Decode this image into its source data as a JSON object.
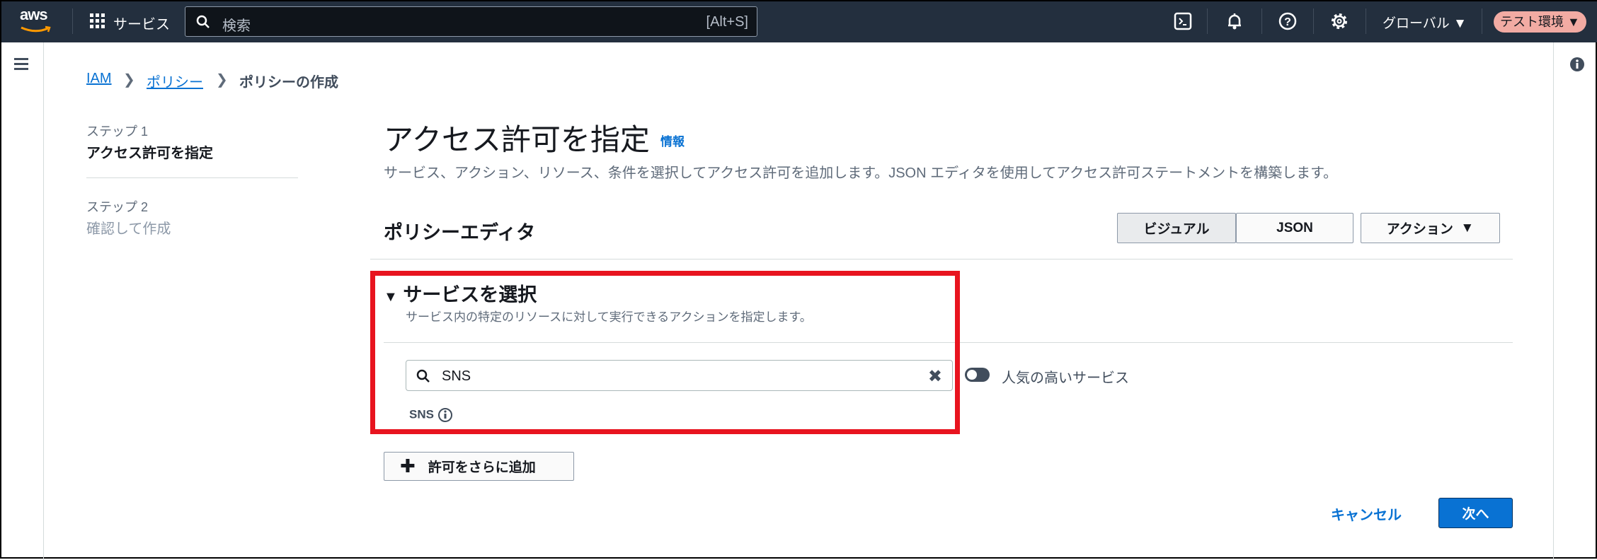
{
  "topbar": {
    "logo": "aws",
    "services": "サービス",
    "search_placeholder": "検索",
    "search_shortcut": "[Alt+S]",
    "region": "グローバル",
    "account": "テスト環境"
  },
  "breadcrumb": {
    "items": [
      "IAM",
      "ポリシー",
      "ポリシーの作成"
    ]
  },
  "steps": [
    {
      "step": "ステップ 1",
      "label": "アクセス許可を指定"
    },
    {
      "step": "ステップ 2",
      "label": "確認して作成"
    }
  ],
  "main": {
    "title": "アクセス許可を指定",
    "info": "情報",
    "description": "サービス、アクション、リソース、条件を選択してアクセス許可を追加します。JSON エディタを使用してアクセス許可ステートメントを構築します。",
    "editor_title": "ポリシーエディタ",
    "tabs": [
      "ビジュアル",
      "JSON"
    ],
    "actions": "アクション",
    "section_title": "サービスを選択",
    "section_desc": "サービス内の特定のリソースに対して実行できるアクションを指定します。",
    "search_value": "SNS",
    "toggle_label": "人気の高いサービス",
    "result": "SNS",
    "add_button": "許可をさらに追加",
    "cancel": "キャンセル",
    "next": "次へ"
  },
  "colors": {
    "highlight": "#e8141f",
    "primary": "#0972d3",
    "topbar": "#232f3e"
  }
}
